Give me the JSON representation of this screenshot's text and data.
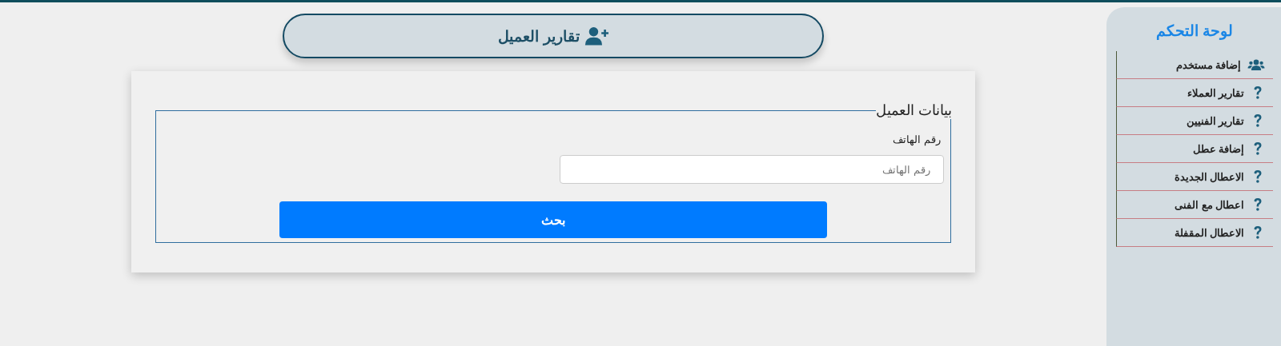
{
  "header": {
    "title": "تقارير العميل"
  },
  "form": {
    "legend": "بيانات العميل",
    "label": "رقم الهاتف",
    "placeholder": "رقم الهاتف",
    "button": "بحث"
  },
  "sidebar": {
    "title": "لوحة التحكم",
    "items": [
      {
        "label": "إضافة مستخدم",
        "kind": "users"
      },
      {
        "label": "تقارير العملاء",
        "kind": "question"
      },
      {
        "label": "تقارير الفنيين",
        "kind": "question"
      },
      {
        "label": "إضافة عطل",
        "kind": "question"
      },
      {
        "label": "الاعطال الجديدة",
        "kind": "question"
      },
      {
        "label": "اعطال مع الفنى",
        "kind": "question"
      },
      {
        "label": "الاعطال المقفلة",
        "kind": "question"
      }
    ]
  }
}
